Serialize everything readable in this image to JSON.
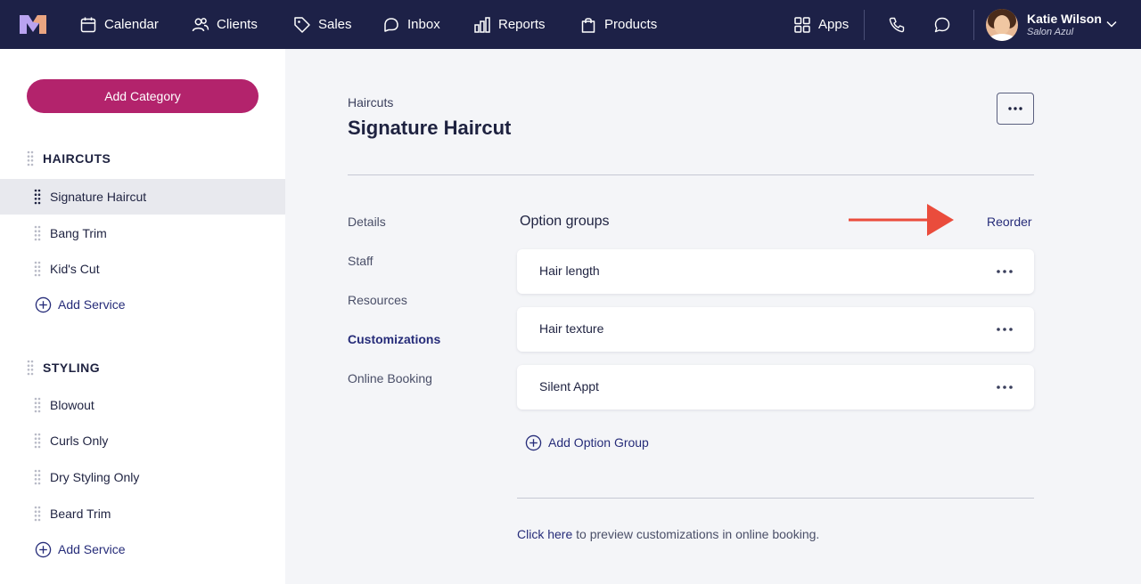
{
  "topnav": {
    "items": [
      {
        "label": "Calendar",
        "icon": "calendar-icon"
      },
      {
        "label": "Clients",
        "icon": "clients-icon"
      },
      {
        "label": "Sales",
        "icon": "tag-icon"
      },
      {
        "label": "Inbox",
        "icon": "inbox-icon"
      },
      {
        "label": "Reports",
        "icon": "bar-chart-icon"
      },
      {
        "label": "Products",
        "icon": "shopping-bag-icon"
      }
    ],
    "apps_label": "Apps",
    "user": {
      "name": "Katie Wilson",
      "salon": "Salon Azul"
    }
  },
  "sidebar": {
    "add_category_label": "Add Category",
    "categories": [
      {
        "name": "HAIRCUTS",
        "services": [
          "Signature Haircut",
          "Bang Trim",
          "Kid's Cut"
        ],
        "add_service_label": "Add Service"
      },
      {
        "name": "STYLING",
        "services": [
          "Blowout",
          "Curls Only",
          "Dry Styling Only",
          "Beard Trim"
        ],
        "add_service_label": "Add Service"
      }
    ],
    "active_service": "Signature Haircut"
  },
  "main": {
    "breadcrumb": "Haircuts",
    "title": "Signature Haircut",
    "subnav": [
      "Details",
      "Staff",
      "Resources",
      "Customizations",
      "Online Booking"
    ],
    "active_subnav": "Customizations",
    "option_groups": {
      "title": "Option groups",
      "reorder_label": "Reorder",
      "items": [
        "Hair length",
        "Hair texture",
        "Silent Appt"
      ],
      "add_label": "Add Option Group"
    },
    "preview": {
      "link_text": "Click here",
      "rest_text": " to preview customizations in online booking."
    }
  },
  "colors": {
    "topbar": "#1d2147",
    "brand_button": "#b3236c",
    "link": "#262c79",
    "annotation_arrow": "#ea4c3c"
  }
}
